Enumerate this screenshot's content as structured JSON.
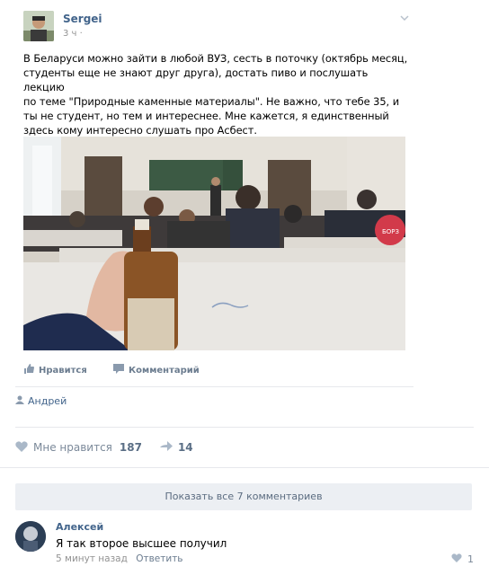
{
  "post": {
    "author": "Sergei",
    "time": "3 ч",
    "text_lines": [
      "В Беларуси можно зайти в любой ВУЗ, сесть в поточку (октябрь месяц,",
      "студенты еще не знают друг друга), достать пиво и послушать лекцию",
      "по теме \"Природные каменные материалы\". Не важно, что тебе 35, и",
      "ты не студент, но тем и интереснее. Мне кажется, я единственный",
      "здесь кому интересно слушать про Асбест."
    ],
    "like_action": "Нравится",
    "comment_action": "Комментарий",
    "shared_by": "Андрей",
    "likes_label": "Мне нравится",
    "likes_count": "187",
    "shares_count": "14"
  },
  "comments": {
    "show_all": "Показать все 7 комментариев",
    "items": [
      {
        "author": "Алексей",
        "text": "Я так второе высшее получил",
        "time": "5 минут назад",
        "reply": "Ответить",
        "likes": "1"
      }
    ]
  },
  "colors": {
    "link": "#42648b",
    "meta": "#939393",
    "underline": "#c0182a",
    "button_bg": "#eceff3"
  }
}
